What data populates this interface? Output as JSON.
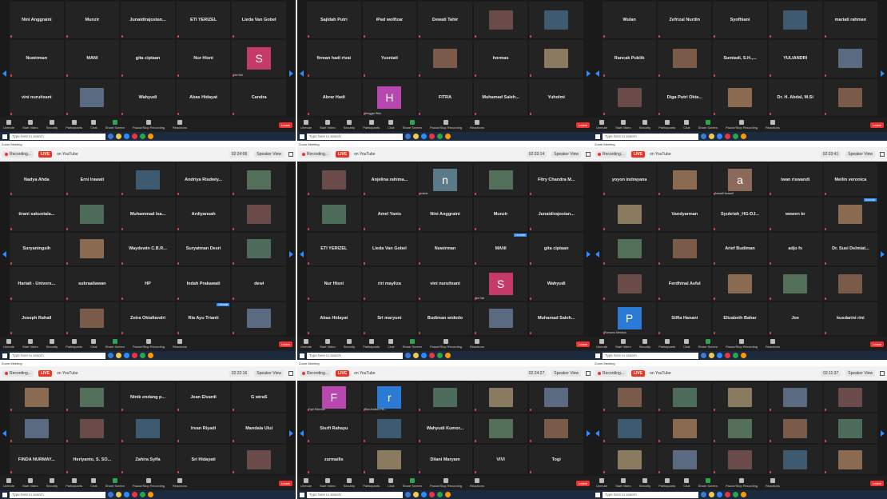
{
  "panels": [
    {
      "id": "p1",
      "time": "",
      "tiles": [
        [
          "Nini Anggraini",
          "Munzir",
          "Junaidirajostan...",
          "ETI YERIZEL",
          "Lieda Van Gobel"
        ],
        [
          "Nuwirman",
          "MANI",
          "gita ciptaan",
          "Nur Hisni",
          "riri mayliza"
        ],
        [
          "vini nuruitsani",
          "",
          "Wahyudi",
          "Abas Hidayat",
          "Candra"
        ]
      ],
      "photos": [
        [
          1,
          4,
          "S",
          "#c43b6a",
          "Nei Nei"
        ]
      ]
    },
    {
      "id": "p2",
      "time": "",
      "tiles": [
        [
          "Sajidah Putri",
          "iPad wolfizar",
          "Dewati Tahir",
          "",
          ""
        ],
        [
          "firman hadi rivai",
          "Yusniati",
          "",
          "hormas",
          ""
        ],
        [
          "Abrar Hadi",
          "",
          "FITRA",
          "Muhamad Saleh...",
          "Yuholmi"
        ]
      ],
      "photos": [
        [
          2,
          1,
          "H",
          "#b847b0",
          "Henggar Rike"
        ]
      ]
    },
    {
      "id": "p3",
      "time": "",
      "tiles": [
        [
          "Wulan",
          "Zefrizal Nurdin",
          "Syofhiani",
          "",
          "mariati rahman"
        ],
        [
          "Rancak Publik",
          "",
          "Sumiadi, S.H.,...",
          "YULIANDRI",
          ""
        ],
        [
          "",
          "Diga Putri Okta...",
          "",
          "Dr. H. Abdal, M.Si",
          ""
        ]
      ],
      "photos": []
    },
    {
      "id": "p4",
      "time": "02:24:06",
      "tiles": [
        [
          "Nadya Ahda",
          "Erni Irawati",
          "",
          "Andriya Risdwiy...",
          ""
        ],
        [
          "tirani sakuntala...",
          "",
          "Muhammad Isa...",
          "Ardiyansah",
          ""
        ],
        [
          "Suryaningsih",
          "",
          "Waydewin C.B.R...",
          "Suryatman Desri",
          ""
        ],
        [
          "Hariati - Univers...",
          "sukraaliawan",
          "HP",
          "Indah Prakawati",
          "dewi"
        ],
        [
          "Joseph Rahail",
          "",
          "Zetra Oktafiandri",
          "Ria Ayu Trianti",
          ""
        ]
      ],
      "photos": []
    },
    {
      "id": "p5",
      "time": "02:23:14",
      "tiles": [
        [
          "",
          "Anjelina rahima...",
          "",
          "",
          "Fitry Chandra M..."
        ],
        [
          "",
          "Amel Yanis",
          "Nini Anggraini",
          "Munzir",
          "Junaidirajostan..."
        ],
        [
          "ETI YERIZEL",
          "Lieda Van Gobel",
          "Nuwirman",
          "MANI",
          "gita ciptaan"
        ],
        [
          "Nur Hisni",
          "riri mayliza",
          "vini nuruitsani",
          "",
          "Wahyudi"
        ],
        [
          "Abas Hidayat",
          "Sri maryuni",
          "Budiman widodo",
          "",
          "Muhamad Saleh..."
        ]
      ],
      "photos": [
        [
          0,
          2,
          "n",
          "#5a7a8a",
          "eviane"
        ],
        [
          3,
          3,
          "S",
          "#c43b6a",
          "Nei Nei"
        ]
      ]
    },
    {
      "id": "p6",
      "time": "02:23:41",
      "tiles": [
        [
          "yoyon indrayana",
          "",
          "",
          "iwan riswandi",
          "Meilin veronica"
        ],
        [
          "",
          "Vandyarman",
          "Syukriah_HG-DJ...",
          "wewen kr",
          ""
        ],
        [
          "",
          "",
          "Arief Budiman",
          "adjo fx",
          "Dr. Susi Delmiat..."
        ],
        [
          "",
          "Ferdhinal Asful",
          "",
          "",
          ""
        ],
        [
          "",
          "Silfia Hanani",
          "Elizabeth Bahar",
          "Joe",
          "kusdarini rini"
        ]
      ],
      "photos": [
        [
          0,
          2,
          "a",
          "#8b6a5a",
          "Aswarfi Azwarfi"
        ],
        [
          4,
          0,
          "P",
          "#2b7bd6",
          "Purnomo Mentrys"
        ]
      ]
    },
    {
      "id": "p7",
      "time": "02:22:16",
      "tiles": [
        [
          "",
          "",
          "Ninik endang p...",
          "Jean Elvardi",
          "G wiraS"
        ],
        [
          "",
          "",
          "",
          "Irvan Riyadi",
          "Mandala Ulul"
        ],
        [
          "FINDA NURMAY...",
          "Heriyanto, S. SO...",
          "Zahira Sylfa",
          "Sri Hidayati",
          ""
        ]
      ],
      "photos": []
    },
    {
      "id": "p8",
      "time": "02:24:27",
      "tiles": [
        [
          "",
          "",
          "",
          "",
          ""
        ],
        [
          "Sisrfi Rahayu",
          "",
          "Wahyudi Kumor...",
          "",
          ""
        ],
        [
          "zurmailis",
          "",
          "Dilani Maryam",
          "VIVI",
          "Togi"
        ]
      ],
      "photos": [
        [
          0,
          0,
          "F",
          "#b847b0",
          "Fajri Rahman"
        ],
        [
          0,
          1,
          "r",
          "#2b7bd6",
          "Riza Andeco Pa..."
        ]
      ]
    },
    {
      "id": "p9",
      "time": "02:11:37",
      "tiles": [
        [
          "",
          "",
          "",
          "",
          ""
        ],
        [
          "",
          "",
          "",
          "",
          ""
        ],
        [
          "",
          "",
          "",
          "",
          ""
        ]
      ],
      "photos": []
    }
  ],
  "labels": {
    "recording": "Recording...",
    "live": "LIVE",
    "youtube": "on YouTube",
    "speaker_view": "Speaker View",
    "zoom_meeting": "Zoom Meeting",
    "unmute_badge": "Unmute",
    "search": "Type here to search",
    "leave": "Leave",
    "toolbar": [
      "Unmute",
      "Start Video",
      "Security",
      "Participants",
      "Chat",
      "Share Screen",
      "Pause/Stop Recording",
      "Reactions"
    ]
  },
  "colors": {
    "live": "#e33333",
    "accent": "#2d8cff",
    "share": "#2ea44f",
    "panel": "#1a1a1a",
    "tile": "#232323"
  }
}
